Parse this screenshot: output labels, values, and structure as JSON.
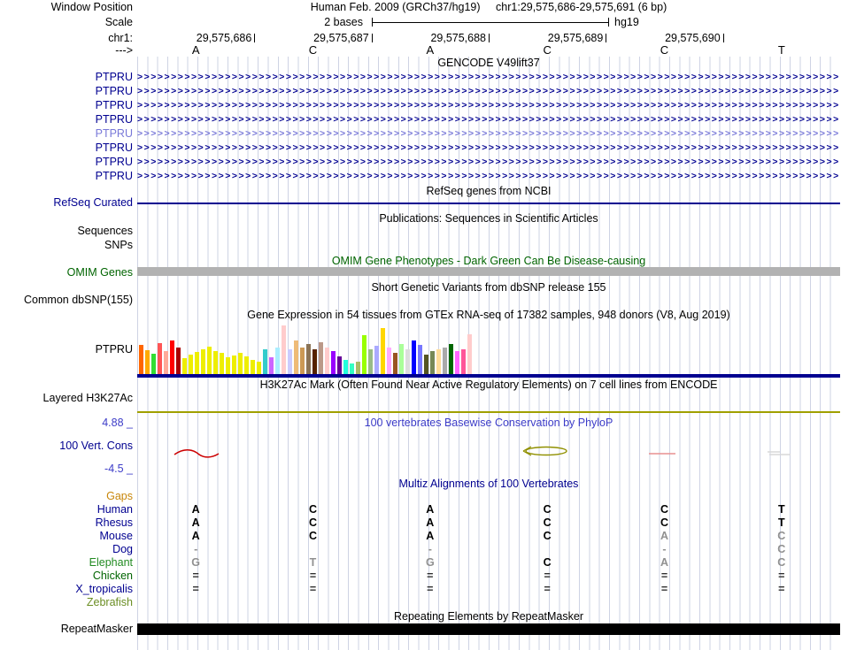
{
  "header": {
    "window_position_label": "Window Position",
    "assembly": "Human Feb. 2009 (GRCh37/hg19)",
    "position": "chr1:29,575,686-29,575,691 (6 bp)",
    "scale_label": "Scale",
    "scale_value": "2 bases",
    "scale_assembly": "hg19",
    "chrom_label": "chr1:",
    "direction_label": "--->"
  },
  "ruler": {
    "coordinates": [
      "29,575,686",
      "29,575,687",
      "29,575,688",
      "29,575,689",
      "29,575,690"
    ],
    "bases": [
      "A",
      "C",
      "A",
      "C",
      "C",
      "T"
    ]
  },
  "gencode": {
    "title": "GENCODE V49lift37",
    "rows": [
      {
        "label": "PTPRU",
        "color": "#000090"
      },
      {
        "label": "PTPRU",
        "color": "#000090"
      },
      {
        "label": "PTPRU",
        "color": "#000090"
      },
      {
        "label": "PTPRU",
        "color": "#000090"
      },
      {
        "label": "PTPRU",
        "color": "#7878d8"
      },
      {
        "label": "PTPRU",
        "color": "#000090"
      },
      {
        "label": "PTPRU",
        "color": "#000090"
      },
      {
        "label": "PTPRU",
        "color": "#000090"
      }
    ]
  },
  "refseq": {
    "title": "RefSeq genes from NCBI",
    "label": "RefSeq Curated",
    "color": "#000090"
  },
  "publications": {
    "title": "Publications: Sequences in Scientific Articles",
    "sequences_label": "Sequences",
    "snps_label": "SNPs"
  },
  "omim": {
    "title": "OMIM Gene Phenotypes - Dark Green Can Be Disease-causing",
    "label": "OMIM Genes",
    "bar_color": "#b2b2b2"
  },
  "dbsnp": {
    "title": "Short Genetic Variants from dbSNP release 155",
    "label": "Common dbSNP(155)"
  },
  "gtex": {
    "title": "Gene Expression in 54 tissues from GTEx RNA-seq of 17382 samples, 948 donors (V8, Aug 2019)",
    "label": "PTPRU",
    "baseline_color": "#000090",
    "bars": [
      [
        "#FF6600",
        33
      ],
      [
        "#FFAA00",
        27
      ],
      [
        "#33DD33",
        23
      ],
      [
        "#FF5555",
        35
      ],
      [
        "#FFAA99",
        26
      ],
      [
        "#FF0000",
        38
      ],
      [
        "#AA0000",
        30
      ],
      [
        "#EEEE00",
        18
      ],
      [
        "#EEEE00",
        22
      ],
      [
        "#EEEE00",
        25
      ],
      [
        "#EEEE00",
        28
      ],
      [
        "#EEEE00",
        31
      ],
      [
        "#EEEE00",
        26
      ],
      [
        "#EEEE00",
        24
      ],
      [
        "#EEEE00",
        19
      ],
      [
        "#EEEE00",
        21
      ],
      [
        "#EEEE00",
        24
      ],
      [
        "#EEEE00",
        20
      ],
      [
        "#EEEE00",
        16
      ],
      [
        "#EEEE00",
        14
      ],
      [
        "#33CCCC",
        28
      ],
      [
        "#CC66FF",
        19
      ],
      [
        "#AAEEFF",
        30
      ],
      [
        "#FFCCCC",
        55
      ],
      [
        "#CCCCFF",
        28
      ],
      [
        "#EEBB77",
        38
      ],
      [
        "#CC9955",
        30
      ],
      [
        "#8B7355",
        34
      ],
      [
        "#552200",
        28
      ],
      [
        "#BB9988",
        36
      ],
      [
        "#FFCCCC",
        30
      ],
      [
        "#9900FF",
        26
      ],
      [
        "#660099",
        20
      ],
      [
        "#22FFDD",
        16
      ],
      [
        "#33FFC2",
        12
      ],
      [
        "#AABB66",
        14
      ],
      [
        "#99FF00",
        44
      ],
      [
        "#99BB88",
        28
      ],
      [
        "#AAAAFF",
        32
      ],
      [
        "#FFD700",
        52
      ],
      [
        "#FFAAFF",
        30
      ],
      [
        "#995522",
        24
      ],
      [
        "#AAFF99",
        34
      ],
      [
        "#DDDDDD",
        28
      ],
      [
        "#0000FF",
        38
      ],
      [
        "#7777FF",
        33
      ],
      [
        "#555522",
        22
      ],
      [
        "#778855",
        26
      ],
      [
        "#FFDD99",
        28
      ],
      [
        "#AAAAAA",
        30
      ],
      [
        "#006600",
        34
      ],
      [
        "#FF66FF",
        26
      ],
      [
        "#FF5599",
        28
      ],
      [
        "#FFCCCC",
        45
      ]
    ]
  },
  "h3k27ac": {
    "title": "H3K27Ac Mark (Often Found Near Active Regulatory Elements) on 7 cell lines from ENCODE",
    "label": "Layered H3K27Ac",
    "line_color": "#a0a000"
  },
  "phylop": {
    "title": "100 vertebrates Basewise Conservation by PhyloP",
    "label": "100 Vert. Cons",
    "max_value": "4.88 _",
    "min_value": "-4.5 _"
  },
  "multiz": {
    "title": "Multiz Alignments of 100 Vertebrates",
    "rows": [
      {
        "label": "Gaps",
        "color": "#c8860a",
        "cells": [
          "",
          "",
          "",
          "",
          "",
          ""
        ],
        "cell_colors": [
          "",
          "",
          "",
          "",
          "",
          ""
        ]
      },
      {
        "label": "Human",
        "color": "#000090",
        "cells": [
          "A",
          "C",
          "A",
          "C",
          "C",
          "T"
        ],
        "cell_colors": [
          "#000000",
          "#000000",
          "#000000",
          "#000000",
          "#000000",
          "#000000"
        ]
      },
      {
        "label": "Rhesus",
        "color": "#000090",
        "cells": [
          "A",
          "C",
          "A",
          "C",
          "C",
          "T"
        ],
        "cell_colors": [
          "#000000",
          "#000000",
          "#000000",
          "#000000",
          "#000000",
          "#000000"
        ]
      },
      {
        "label": "Mouse",
        "color": "#000090",
        "cells": [
          "A",
          "C",
          "A",
          "C",
          "A",
          "C"
        ],
        "cell_colors": [
          "#000000",
          "#000000",
          "#000000",
          "#000000",
          "#909090",
          "#909090"
        ]
      },
      {
        "label": "Dog",
        "color": "#000090",
        "cells": [
          "-",
          "",
          "-",
          "",
          "-",
          "C"
        ],
        "cell_colors": [
          "#909090",
          "",
          "#909090",
          "",
          "#909090",
          "#909090"
        ]
      },
      {
        "label": "Elephant",
        "color": "#228B22",
        "cells": [
          "G",
          "T",
          "G",
          "C",
          "A",
          "C"
        ],
        "cell_colors": [
          "#909090",
          "#909090",
          "#909090",
          "#000000",
          "#909090",
          "#909090"
        ]
      },
      {
        "label": "Chicken",
        "color": "#006400",
        "cells": [
          "=",
          "=",
          "=",
          "=",
          "=",
          "="
        ],
        "cell_colors": [
          "#303030",
          "#303030",
          "#303030",
          "#303030",
          "#303030",
          "#303030"
        ]
      },
      {
        "label": "X_tropicalis",
        "color": "#000090",
        "cells": [
          "=",
          "=",
          "=",
          "=",
          "=",
          "="
        ],
        "cell_colors": [
          "#303030",
          "#303030",
          "#303030",
          "#303030",
          "#303030",
          "#303030"
        ]
      },
      {
        "label": "Zebrafish",
        "color": "#6B8E23",
        "cells": [
          "",
          "",
          "",
          "",
          "",
          ""
        ],
        "cell_colors": [
          "",
          "",
          "",
          "",
          "",
          ""
        ]
      }
    ]
  },
  "repeatmasker": {
    "title": "Repeating Elements by RepeatMasker",
    "label": "RepeatMasker",
    "bar_color": "#000000"
  }
}
